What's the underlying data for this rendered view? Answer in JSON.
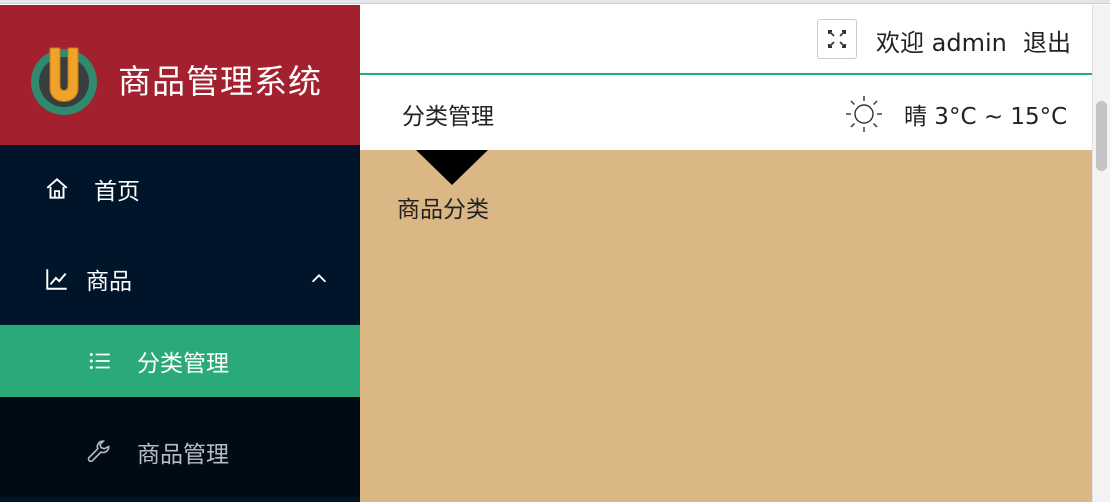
{
  "app": {
    "title": "商品管理系统"
  },
  "sidebar": {
    "items": [
      {
        "label": "首页",
        "icon": "home-icon"
      },
      {
        "label": "商品",
        "icon": "chart-line-icon"
      },
      {
        "label": "分类管理",
        "icon": "list-icon",
        "active": true
      },
      {
        "label": "商品管理",
        "icon": "wrench-icon"
      }
    ]
  },
  "header": {
    "welcome": "欢迎 admin",
    "logout": "退出",
    "fullscreen_icon": "fullscreen-icon"
  },
  "breadcrumb": {
    "current": "分类管理"
  },
  "weather": {
    "text": "晴 3°C ~ 15°C",
    "icon": "sun-icon"
  },
  "content": {
    "card_title": "商品分类"
  },
  "colors": {
    "logo_bg": "#a3212e",
    "sidebar_bg": "#001529",
    "active": "#2aaa79",
    "content_bg": "#dcb786"
  }
}
